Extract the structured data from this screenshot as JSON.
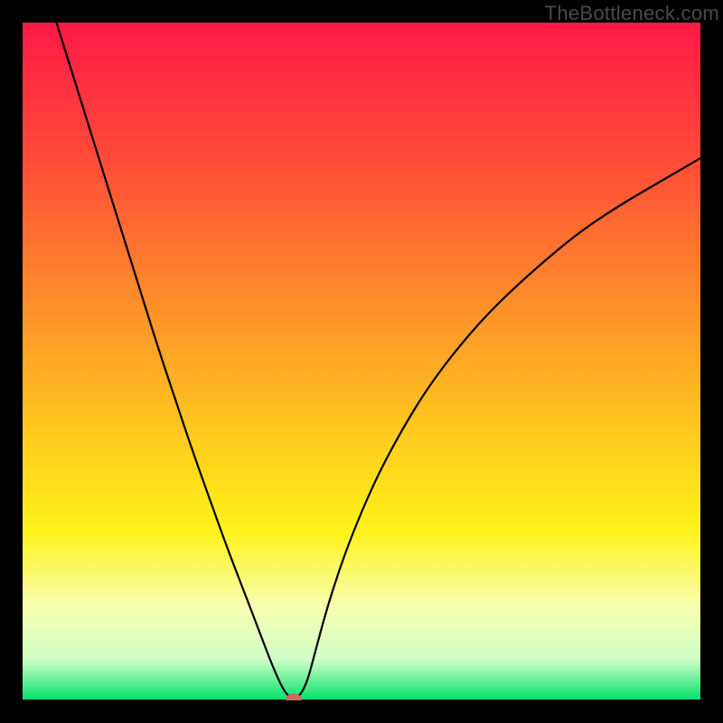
{
  "watermark": "TheBottleneck.com",
  "chart_data": {
    "type": "line",
    "title": "",
    "xlabel": "",
    "ylabel": "",
    "xlim": [
      0,
      100
    ],
    "ylim": [
      0,
      100
    ],
    "background_gradient": {
      "stops": [
        {
          "offset": 0.0,
          "color": "#ff1948"
        },
        {
          "offset": 0.2,
          "color": "#ff4b38"
        },
        {
          "offset": 0.4,
          "color": "#ff8a2c"
        },
        {
          "offset": 0.6,
          "color": "#ffc81e"
        },
        {
          "offset": 0.75,
          "color": "#fff31a"
        },
        {
          "offset": 0.86,
          "color": "#f8ffaf"
        },
        {
          "offset": 0.94,
          "color": "#cfffc8"
        },
        {
          "offset": 1.0,
          "color": "#00e06a"
        }
      ]
    },
    "series": [
      {
        "name": "bottleneck-curve",
        "color": "#000000",
        "width": 2.2,
        "x": [
          5.0,
          7.5,
          10.0,
          12.5,
          15.0,
          17.5,
          20.0,
          22.5,
          25.0,
          27.5,
          30.0,
          32.5,
          35.0,
          36.5,
          38.0,
          39.0,
          40.0,
          41.0,
          42.0,
          43.0,
          45.0,
          48.0,
          52.0,
          56.0,
          60.0,
          65.0,
          70.0,
          76.0,
          82.0,
          88.0,
          94.0,
          100.0
        ],
        "values": [
          100.0,
          92.0,
          84.0,
          76.0,
          68.0,
          60.0,
          52.0,
          44.5,
          37.0,
          30.0,
          23.0,
          16.5,
          10.0,
          6.0,
          2.5,
          0.8,
          0.2,
          0.8,
          2.8,
          6.5,
          14.0,
          23.0,
          32.5,
          40.0,
          46.5,
          53.0,
          58.5,
          64.0,
          69.0,
          73.0,
          76.5,
          80.0
        ]
      }
    ],
    "marker": {
      "name": "minimum-point",
      "x": 40.0,
      "y": 0.2,
      "color": "#cf6a63",
      "rx": 9,
      "ry": 6
    },
    "baseline": {
      "y": 0,
      "stroke": "#000000",
      "strokeWidth": 2
    }
  }
}
